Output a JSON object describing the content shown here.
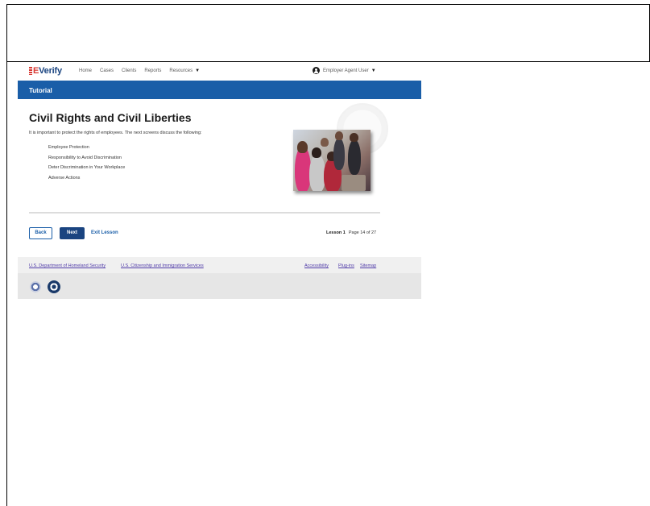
{
  "logo": {
    "text": "Verify",
    "prefix": "E"
  },
  "nav": {
    "items": [
      "Home",
      "Cases",
      "Clients",
      "Reports",
      "Resources"
    ],
    "user": "Employer Agent User"
  },
  "banner": {
    "title": "Tutorial"
  },
  "content": {
    "title": "Civil Rights and Civil Liberties",
    "intro": "It is important to protect the rights of employees. The next screens discuss the following:",
    "topics": [
      "Employee Protection",
      "Responsibility to Avoid Discrimination",
      "Deter Discrimination in Your Workplace",
      "Adverse Actions"
    ]
  },
  "actions": {
    "back": "Back",
    "next": "Next",
    "exit": "Exit Lesson",
    "lesson": "Lesson 1",
    "page": "Page 14 of 27"
  },
  "footer": {
    "dhs": "U.S. Department of Homeland Security",
    "uscis": "U.S. Citizenship and Immigration Services",
    "accessibility": "Accessibility",
    "plugins": "Plug-ins",
    "sitemap": "Sitemap"
  },
  "colors": {
    "brand_blue": "#1a5ea8",
    "button_blue": "#1a4480",
    "logo_red": "#d83933"
  }
}
